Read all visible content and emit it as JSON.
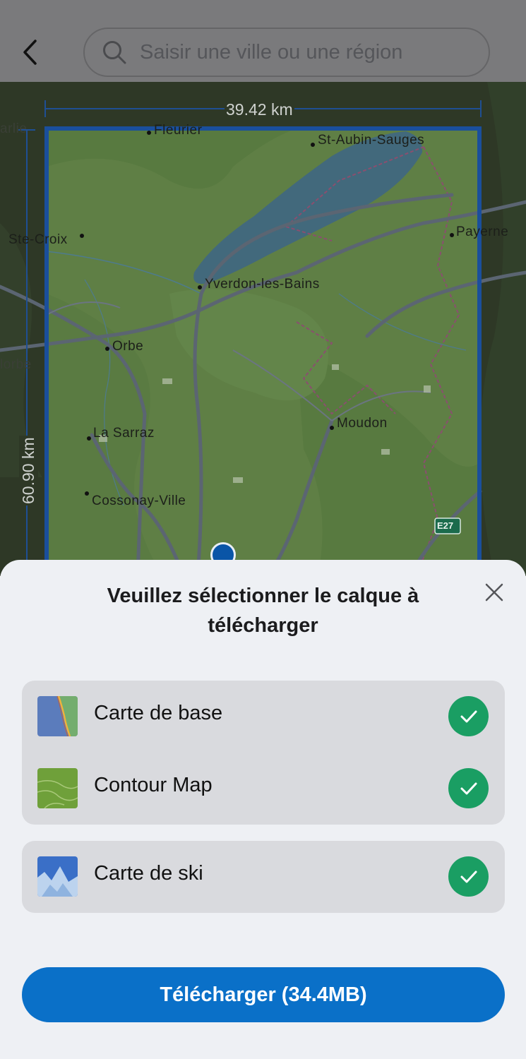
{
  "header": {
    "back_icon": "chevron-left-icon",
    "search_icon": "search-icon",
    "search_placeholder": "Saisir une ville ou une région",
    "search_value": ""
  },
  "map": {
    "width_label": "39.42 km",
    "height_label": "60.90 km",
    "places": {
      "fleurier": "Fleurier",
      "st_aubin": "St-Aubin-Sauges",
      "vallorbe_edge": "arlie",
      "ste_croix": "Ste-Croix",
      "payerne": "Payerne",
      "yverdon": "Yverdon-les-Bains",
      "orbe": "Orbe",
      "orbe_edge": "lorbe",
      "moudon": "Moudon",
      "la_sarraz": "La Sarraz",
      "cossonay": "Cossonay-Ville"
    },
    "road_badge": "E27",
    "location_icon": "location-pin-icon"
  },
  "sheet": {
    "title": "Veuillez sélectionner le calque à télécharger",
    "close_icon": "close-icon",
    "layers": [
      {
        "label": "Carte de base",
        "checked": true,
        "icon": "base-map-thumbnail"
      },
      {
        "label": "Contour Map",
        "checked": true,
        "icon": "contour-map-thumbnail"
      },
      {
        "label": "Carte de ski",
        "checked": true,
        "icon": "ski-map-thumbnail"
      }
    ],
    "download_label": "Télécharger (34.4MB)"
  },
  "colors": {
    "accent": "#0a70c8",
    "check": "#1a9e63",
    "selection_border": "#1a4f9c"
  }
}
